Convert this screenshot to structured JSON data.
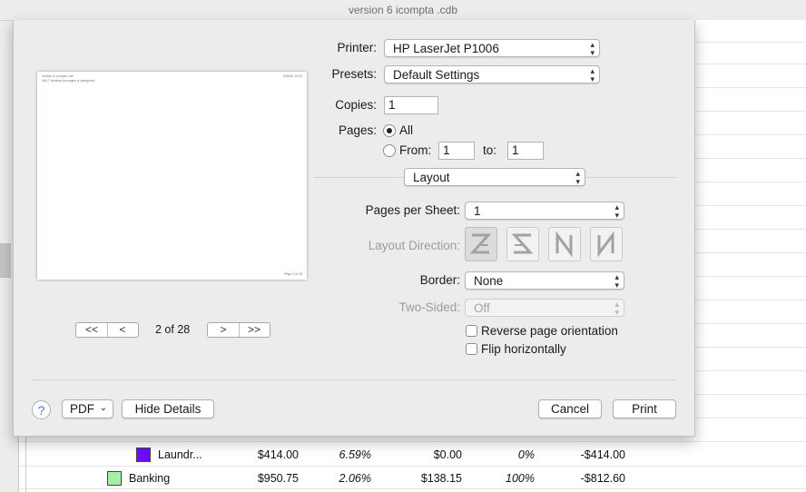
{
  "window": {
    "title": "version 6 icompta .cdb"
  },
  "background_rows": [
    {
      "name": "Laundr...",
      "amount": "$414.00",
      "percent": "6.59%",
      "budget": "$0.00",
      "budget_percent": "0%",
      "difference": "-$414.00",
      "color": "#6a0dff"
    },
    {
      "name": "Banking",
      "amount": "$950.75",
      "percent": "2.06%",
      "budget": "$138.15",
      "budget_percent": "100%",
      "difference": "-$812.60",
      "color": "#a6f0a6"
    }
  ],
  "preview": {
    "header_left_1": "version 6 icompta .cdb",
    "header_left_2": "06/17 Monthly Averages of categories",
    "header_right": "2/08/16  14:03",
    "footer": "Page 2 of 28",
    "page_count": "2 of 28",
    "nav_first": "<<",
    "nav_prev": "<",
    "nav_next": ">",
    "nav_last": ">>"
  },
  "printer": {
    "label": "Printer:",
    "value": "HP LaserJet P1006"
  },
  "presets": {
    "label": "Presets:",
    "value": "Default Settings"
  },
  "copies": {
    "label": "Copies:",
    "value": "1"
  },
  "pages": {
    "label": "Pages:",
    "all_label": "All",
    "from_label": "From:",
    "from_value": "1",
    "to_label": "to:",
    "to_value": "1"
  },
  "section": {
    "value": "Layout"
  },
  "layout": {
    "pages_per_sheet_label": "Pages per Sheet:",
    "pages_per_sheet_value": "1",
    "direction_label": "Layout Direction:",
    "border_label": "Border:",
    "border_value": "None",
    "two_sided_label": "Two-Sided:",
    "two_sided_value": "Off",
    "reverse_label": "Reverse page orientation",
    "flip_label": "Flip horizontally"
  },
  "footer": {
    "help": "?",
    "pdf_label": "PDF",
    "hide_details": "Hide Details",
    "cancel": "Cancel",
    "print": "Print"
  },
  "icons": {
    "popup_arrows": "⌃⌄",
    "chevron": "⌄"
  }
}
